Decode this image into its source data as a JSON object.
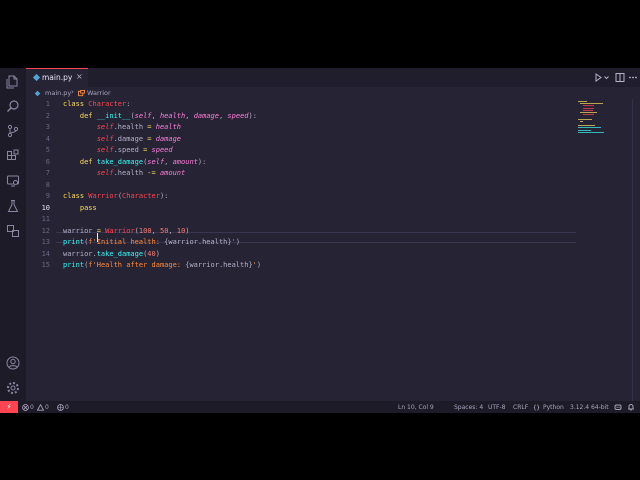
{
  "tab": {
    "filename": "main.py",
    "close_glyph": "×"
  },
  "breadcrumb": {
    "file": "main.py",
    "separator": "›",
    "symbol": "Warrior"
  },
  "code": {
    "current_line": 10,
    "lines": [
      {
        "n": "1",
        "tokens": [
          [
            "kw",
            "class "
          ],
          [
            "cls",
            "Character"
          ],
          [
            "pl",
            ":"
          ]
        ]
      },
      {
        "n": "2",
        "tokens": [
          [
            "pl",
            "    "
          ],
          [
            "kw",
            "def "
          ],
          [
            "fn",
            "__init__"
          ],
          [
            "pl",
            "("
          ],
          [
            "prm",
            "self"
          ],
          [
            "pl",
            ", "
          ],
          [
            "prm",
            "health"
          ],
          [
            "pl",
            ", "
          ],
          [
            "prm",
            "damage"
          ],
          [
            "pl",
            ", "
          ],
          [
            "prm",
            "speed"
          ],
          [
            "pl",
            "):"
          ]
        ]
      },
      {
        "n": "3",
        "tokens": [
          [
            "pl",
            "        "
          ],
          [
            "slf",
            "self"
          ],
          [
            "pl",
            ".health "
          ],
          [
            "op",
            "="
          ],
          [
            "pl",
            " "
          ],
          [
            "prm",
            "health"
          ]
        ]
      },
      {
        "n": "4",
        "tokens": [
          [
            "pl",
            "        "
          ],
          [
            "slf",
            "self"
          ],
          [
            "pl",
            ".damage "
          ],
          [
            "op",
            "="
          ],
          [
            "pl",
            " "
          ],
          [
            "prm",
            "damage"
          ]
        ]
      },
      {
        "n": "5",
        "tokens": [
          [
            "pl",
            "        "
          ],
          [
            "slf",
            "self"
          ],
          [
            "pl",
            ".speed "
          ],
          [
            "op",
            "="
          ],
          [
            "pl",
            " "
          ],
          [
            "prm",
            "speed"
          ]
        ]
      },
      {
        "n": "6",
        "tokens": [
          [
            "pl",
            "    "
          ],
          [
            "kw",
            "def "
          ],
          [
            "fn",
            "take_damage"
          ],
          [
            "pl",
            "("
          ],
          [
            "prm",
            "self"
          ],
          [
            "pl",
            ", "
          ],
          [
            "prm",
            "amount"
          ],
          [
            "pl",
            "):"
          ]
        ]
      },
      {
        "n": "7",
        "tokens": [
          [
            "pl",
            "        "
          ],
          [
            "slf",
            "self"
          ],
          [
            "pl",
            ".health "
          ],
          [
            "op",
            "-="
          ],
          [
            "pl",
            " "
          ],
          [
            "prm",
            "amount"
          ]
        ]
      },
      {
        "n": "8",
        "tokens": []
      },
      {
        "n": "9",
        "tokens": [
          [
            "kw",
            "class "
          ],
          [
            "cls",
            "Warrior"
          ],
          [
            "pl",
            "("
          ],
          [
            "cls",
            "Character"
          ],
          [
            "pl",
            "):"
          ]
        ]
      },
      {
        "n": "10",
        "tokens": [
          [
            "pl",
            "    "
          ],
          [
            "kw",
            "pass"
          ]
        ]
      },
      {
        "n": "11",
        "tokens": []
      },
      {
        "n": "12",
        "tokens": [
          [
            "pl",
            "warrior "
          ],
          [
            "op",
            "="
          ],
          [
            "pl",
            " "
          ],
          [
            "cls",
            "Warrior"
          ],
          [
            "pl",
            "("
          ],
          [
            "num",
            "100"
          ],
          [
            "pl",
            ", "
          ],
          [
            "num",
            "50"
          ],
          [
            "pl",
            ", "
          ],
          [
            "num",
            "10"
          ],
          [
            "pl",
            ")"
          ]
        ]
      },
      {
        "n": "13",
        "tokens": [
          [
            "fn",
            "print"
          ],
          [
            "pl",
            "("
          ],
          [
            "str",
            "f'Initial health: "
          ],
          [
            "pl",
            "{warrior.health}"
          ],
          [
            "str",
            "'"
          ],
          [
            "pl",
            ")"
          ]
        ]
      },
      {
        "n": "14",
        "tokens": [
          [
            "pl",
            "warrior."
          ],
          [
            "fn",
            "take_damage"
          ],
          [
            "pl",
            "("
          ],
          [
            "num",
            "40"
          ],
          [
            "pl",
            ")"
          ]
        ]
      },
      {
        "n": "15",
        "tokens": [
          [
            "fn",
            "print"
          ],
          [
            "pl",
            "("
          ],
          [
            "str",
            "f'Health after damage: "
          ],
          [
            "pl",
            "{warrior.health}"
          ],
          [
            "str",
            "'"
          ],
          [
            "pl",
            ")"
          ]
        ]
      }
    ]
  },
  "statusbar": {
    "remote_glyph": "⚡",
    "errors": "0",
    "warnings": "0",
    "ports": "0",
    "position": "Ln 10, Col 9",
    "spaces": "Spaces: 4",
    "encoding": "UTF-8",
    "eol": "CRLF",
    "language": "Python",
    "interpreter": "3.12.4 64-bit"
  },
  "colors": {
    "editor_bg": "#262335",
    "sidebar_bg": "#1e1b29",
    "accent": "#fe4450",
    "keyword": "#fede5d",
    "function": "#36f9f6",
    "parameter": "#ff7edb",
    "string": "#ff8b39",
    "number": "#f97e72"
  },
  "icons": {
    "activity_bar": [
      "files-icon",
      "search-icon",
      "source-control-icon",
      "extensions-icon",
      "remote-explorer-icon",
      "testing-icon",
      "docker-icon",
      "account-icon",
      "settings-gear-icon"
    ],
    "title_actions": [
      "run-icon",
      "chevron-down-icon",
      "split-editor-icon",
      "more-icon"
    ]
  }
}
